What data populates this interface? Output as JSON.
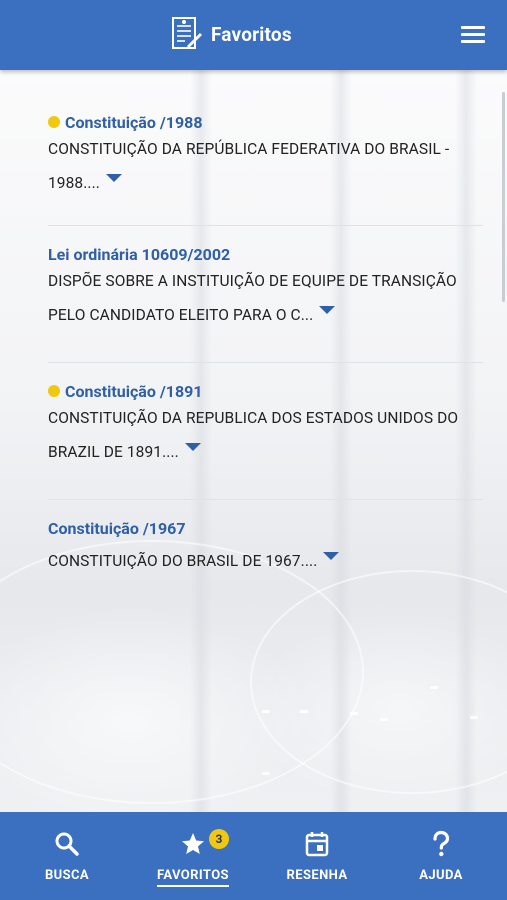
{
  "header": {
    "title": "Favoritos",
    "menu_icon": "hamburger-menu-icon",
    "logo_icon": "document-pen-icon"
  },
  "colors": {
    "primary": "#3b6fc0",
    "link": "#2f5fa6",
    "highlight_dot": "#f2c80f"
  },
  "favorites": [
    {
      "law": "Constituição /1988",
      "description": "CONSTITUIÇÃO DA REPÚBLICA FEDERATIVA DO BRASIL - 1988....",
      "marked": true
    },
    {
      "law": "Lei ordinária 10609/2002",
      "description": "DISPÕE SOBRE A INSTITUIÇÃO DE EQUIPE DE TRANSIÇÃO PELO CANDIDATO ELEITO PARA O C...",
      "marked": false
    },
    {
      "law": "Constituição /1891",
      "description": "CONSTITUIÇÃO DA REPUBLICA DOS ESTADOS UNIDOS DO BRAZIL DE 1891....",
      "marked": true
    },
    {
      "law": "Constituição /1967",
      "description": "CONSTITUIÇÃO DO BRASIL DE 1967....",
      "marked": false
    }
  ],
  "bottom_nav": [
    {
      "label": "BUSCA",
      "icon": "search-icon",
      "active": false
    },
    {
      "label": "FAVORITOS",
      "icon": "star-icon",
      "active": true,
      "badge": "3"
    },
    {
      "label": "RESENHA",
      "icon": "calendar-icon",
      "active": false
    },
    {
      "label": "AJUDA",
      "icon": "help-icon",
      "active": false
    }
  ]
}
